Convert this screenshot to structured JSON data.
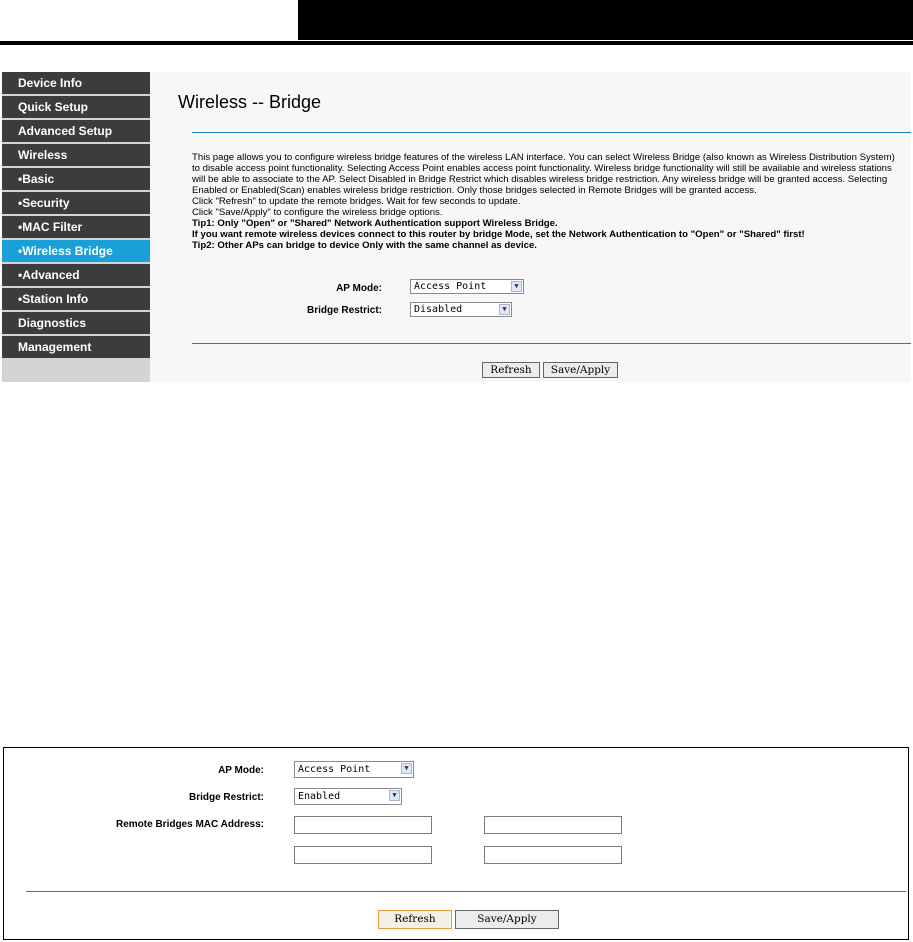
{
  "screen1": {
    "sidebar": {
      "items": [
        {
          "label": "Device Info"
        },
        {
          "label": "Quick Setup"
        },
        {
          "label": "Advanced Setup"
        },
        {
          "label": "Wireless"
        },
        {
          "label": "•Basic"
        },
        {
          "label": "•Security"
        },
        {
          "label": "•MAC Filter"
        },
        {
          "label": "•Wireless Bridge",
          "active": true
        },
        {
          "label": "•Advanced"
        },
        {
          "label": "•Station Info"
        },
        {
          "label": "Diagnostics"
        },
        {
          "label": "Management"
        }
      ]
    },
    "title": "Wireless -- Bridge",
    "description": [
      "This page allows you to configure wireless bridge features of the wireless LAN interface. You can select Wireless Bridge (also known as Wireless Distribution System) to disable access point functionality. Selecting Access Point enables access point functionality. Wireless bridge functionality will still be available and wireless stations will be able to associate to the AP. Select Disabled in Bridge Restrict which disables wireless bridge restriction. Any wireless bridge will be granted access. Selecting Enabled or Enabled(Scan) enables wireless bridge restriction. Only those bridges selected in Remote Bridges will be granted access.",
      "Click \"Refresh\" to update the remote bridges. Wait for few seconds to update.",
      "Click \"Save/Apply\" to configure the wireless bridge options."
    ],
    "tips": [
      "Tip1: Only \"Open\" or \"Shared\" Network Authentication support Wireless Bridge.",
      "If you want remote wireless devices connect to this router by bridge Mode, set the Network Authentication to \"Open\" or \"Shared\" first!",
      "Tip2: Other APs can bridge to device Only with the same channel as device."
    ],
    "ap_mode_label": "AP Mode:",
    "ap_mode_value": "Access Point",
    "bridge_restrict_label": "Bridge Restrict:",
    "bridge_restrict_value": "Disabled",
    "refresh_label": "Refresh",
    "save_label": "Save/Apply"
  },
  "screen2": {
    "ap_mode_label": "AP Mode:",
    "ap_mode_value": "Access Point",
    "bridge_restrict_label": "Bridge Restrict:",
    "bridge_restrict_value": "Enabled",
    "remote_mac_label": "Remote Bridges MAC Address:",
    "mac_fields": [
      "",
      "",
      "",
      ""
    ],
    "refresh_label": "Refresh",
    "save_label": "Save/Apply"
  },
  "colors": {
    "active_nav": "#1aa0d8",
    "nav_bg": "#3c3c3c",
    "rule": "#1a80b8"
  }
}
